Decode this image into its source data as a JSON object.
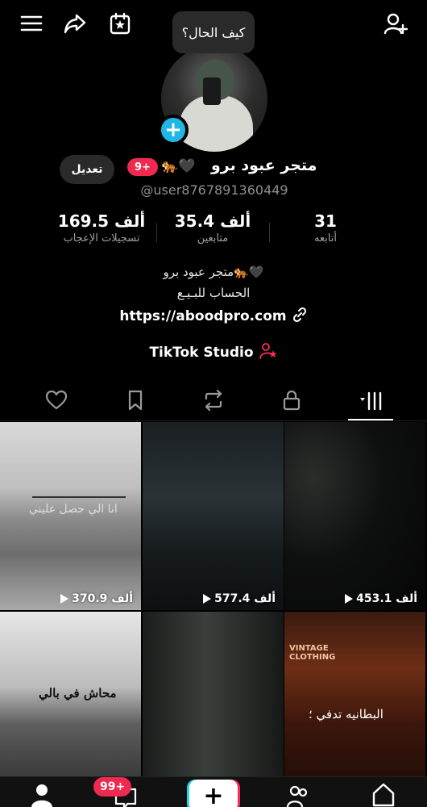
{
  "tooltip": "كيف الحال؟",
  "profile": {
    "display_name": "متجر عبود برو",
    "name_emoji": "🐅🖤",
    "notification_count": "9+",
    "edit_label": "تعديل",
    "username": "@user8767891360449"
  },
  "stats": [
    {
      "value": "169.5 ألف",
      "label": "تسجيلات الإعجاب"
    },
    {
      "value": "35.4 ألف",
      "label": "متابعين"
    },
    {
      "value": "31",
      "label": "أتابعه"
    }
  ],
  "bio": {
    "line1": "متجر عبود برو🐅🖤",
    "line2": "الحساب للبـيـع",
    "link": "https://aboodpro.com",
    "studio": "TikTok Studio"
  },
  "tabs": [
    "liked-tab",
    "favorites-tab",
    "reposts-tab",
    "private-tab",
    "videos-tab"
  ],
  "videos": [
    {
      "views": "453.1 ألف",
      "overlay": ""
    },
    {
      "views": "577.4 ألف",
      "overlay": ""
    },
    {
      "views": "370.9 ألف",
      "overlay": "انا الي حصل عليني"
    },
    {
      "views": "",
      "overlay": "البطانيه تدفي ؛"
    },
    {
      "views": "",
      "overlay": ""
    },
    {
      "views": "",
      "overlay": "محاش في بالي"
    }
  ],
  "tile_labels": {
    "vintage": "VINTAGE CLOTHING"
  },
  "bottom_nav": {
    "inbox_badge": "99+",
    "create_label": "+"
  },
  "colors": {
    "accent_red": "#ef2950",
    "accent_blue": "#1fb7e6",
    "background": "#000000"
  }
}
